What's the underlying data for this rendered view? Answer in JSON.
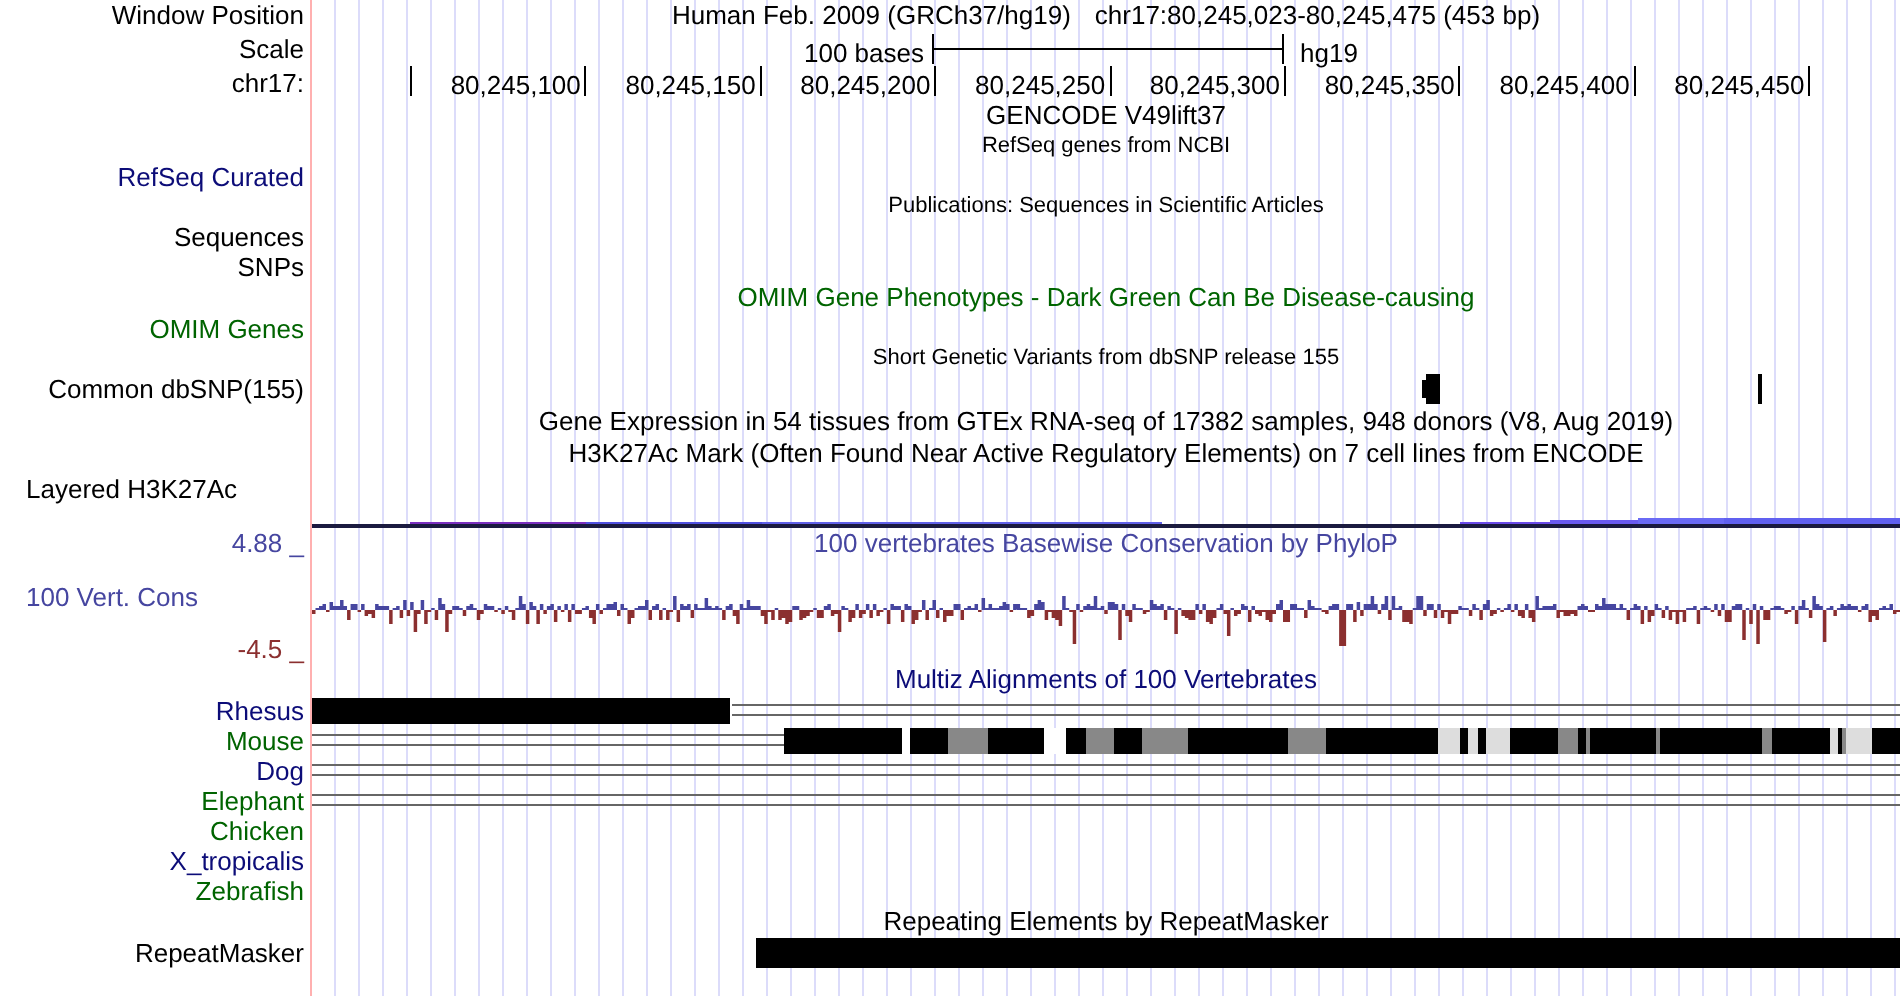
{
  "header": {
    "position_label": "Window Position",
    "assembly_text": "Human Feb. 2009 (GRCh37/hg19)",
    "position_text": "chr17:80,245,023-80,245,475 (453 bp)",
    "scale_label": "Scale",
    "scale_text": "100 bases",
    "scale_assembly": "hg19",
    "chrom_label": "chr17:",
    "ticks": [
      "80,245,100",
      "80,245,150",
      "80,245,200",
      "80,245,250",
      "80,245,300",
      "80,245,350",
      "80,245,400",
      "80,245,450"
    ]
  },
  "tracks": [
    {
      "kind": "title",
      "text": "GENCODE V49lift37",
      "color": "#000000"
    },
    {
      "kind": "note",
      "text": "RefSeq genes from NCBI"
    },
    {
      "kind": "label",
      "label": "RefSeq Curated",
      "color": "#0c0c78"
    },
    {
      "kind": "note",
      "text": "Publications: Sequences in Scientific Articles"
    },
    {
      "kind": "label",
      "label": "Sequences",
      "color": "#000000"
    },
    {
      "kind": "label",
      "label": "SNPs",
      "color": "#000000"
    },
    {
      "kind": "title",
      "text": "OMIM Gene Phenotypes - Dark Green Can Be Disease-causing",
      "color": "#006400"
    },
    {
      "kind": "label",
      "label": "OMIM Genes",
      "color": "#006400"
    },
    {
      "kind": "note",
      "text": "Short Genetic Variants from dbSNP release 155"
    },
    {
      "kind": "snp",
      "label": "Common dbSNP(155)"
    },
    {
      "kind": "title",
      "text": "Gene Expression in 54 tissues from GTEx RNA-seq of 17382 samples, 948 donors (V8, Aug 2019)",
      "color": "#000000"
    },
    {
      "kind": "title",
      "text": "H3K27Ac Mark (Often Found Near Active Regulatory Elements) on 7 cell lines from ENCODE",
      "color": "#000000"
    },
    {
      "kind": "signal",
      "label": "Layered H3K27Ac"
    },
    {
      "kind": "phylop",
      "label": "100 Vert. Cons",
      "color": "#4646a0",
      "title": "100 vertebrates Basewise Conservation by PhyloP",
      "max": {
        "text": "4.88 _",
        "color": "#4646a0"
      },
      "min": {
        "text": "-4.5 _",
        "color": "#8b2f2f"
      }
    },
    {
      "kind": "title",
      "text": "Multiz Alignments of 100 Vertebrates",
      "color": "#0c0c78"
    },
    {
      "kind": "alignleft",
      "label": "Rhesus",
      "color": "#0c0c78"
    },
    {
      "kind": "alignright",
      "label": "Mouse",
      "color": "#006400"
    },
    {
      "kind": "gapped",
      "label": "Dog",
      "color": "#0c0c78"
    },
    {
      "kind": "gapped",
      "label": "Elephant",
      "color": "#006400"
    },
    {
      "kind": "unaligned",
      "label": "Chicken",
      "color": "#006400"
    },
    {
      "kind": "unaligned",
      "label": "X_tropicalis",
      "color": "#0c0c78"
    },
    {
      "kind": "unaligned",
      "label": "Zebrafish",
      "color": "#006400"
    },
    {
      "kind": "title",
      "text": "Repeating Elements by RepeatMasker",
      "color": "#000000"
    },
    {
      "kind": "repeat",
      "label": "RepeatMasker"
    }
  ]
}
